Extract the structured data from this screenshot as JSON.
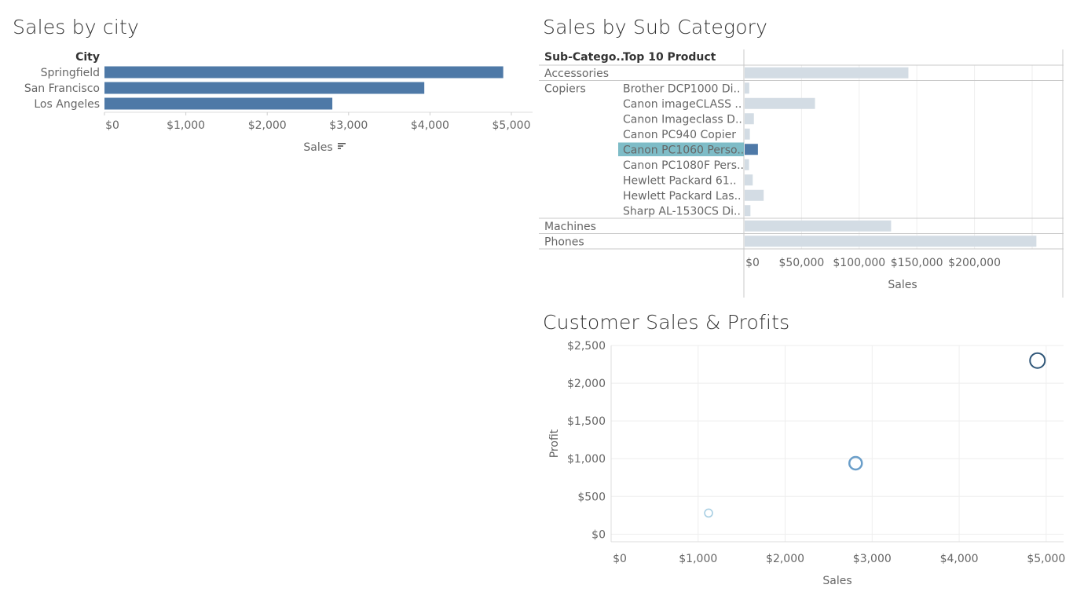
{
  "dashboard": {
    "city_title": "Sales by city",
    "subcat_title": "Sales by Sub Category",
    "scatter_title": "Customer Sales & Profits"
  },
  "chart_data": [
    {
      "type": "bar",
      "title": "Sales by city",
      "row_header": "City",
      "categories": [
        "Springfield",
        "San Francisco",
        "Los Angeles"
      ],
      "values": [
        4900,
        3930,
        2800
      ],
      "xlabel": "Sales",
      "xlim": [
        0,
        5000
      ],
      "xticks": [
        0,
        1000,
        2000,
        3000,
        4000,
        5000
      ],
      "xtick_labels": [
        "$0",
        "$1,000",
        "$2,000",
        "$3,000",
        "$4,000",
        "$5,000"
      ],
      "color": "#4e79a7",
      "sort_icon": "sort-descending-icon"
    },
    {
      "type": "bar",
      "title": "Sales by Sub Category",
      "col_headers": [
        "Sub-Catego..",
        "Top 10 Product"
      ],
      "rows": [
        {
          "subcat": "Accessories",
          "product": "",
          "value": 142000
        },
        {
          "subcat": "Copiers",
          "product": "Brother DCP1000 Di..",
          "value": 4000
        },
        {
          "subcat": "",
          "product": "Canon imageCLASS ..",
          "value": 61000
        },
        {
          "subcat": "",
          "product": "Canon Imageclass D..",
          "value": 8000
        },
        {
          "subcat": "",
          "product": "Canon PC940 Copier",
          "value": 4500
        },
        {
          "subcat": "",
          "product": "Canon PC1060 Perso..",
          "value": 11500,
          "selected": true
        },
        {
          "subcat": "",
          "product": "Canon PC1080F Pers..",
          "value": 3800
        },
        {
          "subcat": "",
          "product": "Hewlett Packard 61..",
          "value": 7000
        },
        {
          "subcat": "",
          "product": "Hewlett Packard Las..",
          "value": 16500
        },
        {
          "subcat": "",
          "product": "Sharp AL-1530CS Di..",
          "value": 5000
        },
        {
          "subcat": "Machines",
          "product": "",
          "value": 127000
        },
        {
          "subcat": "Phones",
          "product": "",
          "value": 253000
        }
      ],
      "xlabel": "Sales",
      "xlim": [
        0,
        265000
      ],
      "xticks": [
        0,
        50000,
        100000,
        150000,
        200000
      ],
      "xtick_labels": [
        "$0",
        "$50,000",
        "$100,000",
        "$150,000",
        "$200,000"
      ],
      "bar_color": "#d3dce4",
      "selected_color": "#4e79a7",
      "selected_label_bg": "#7ebcc7"
    },
    {
      "type": "scatter",
      "title": "Customer Sales & Profits",
      "xlabel": "Sales",
      "ylabel": "Profit",
      "xlim": [
        0,
        5200
      ],
      "ylim": [
        -100,
        2500
      ],
      "xticks": [
        0,
        1000,
        2000,
        3000,
        4000,
        5000
      ],
      "xtick_labels": [
        "$0",
        "$1,000",
        "$2,000",
        "$3,000",
        "$4,000",
        "$5,000"
      ],
      "yticks": [
        0,
        500,
        1000,
        1500,
        2000,
        2500
      ],
      "ytick_labels": [
        "$0",
        "$500",
        "$1,000",
        "$1,500",
        "$2,000",
        "$2,500"
      ],
      "points": [
        {
          "x": 1120,
          "y": 280,
          "size": "small",
          "color": "#a9cfe3"
        },
        {
          "x": 2810,
          "y": 940,
          "size": "medium",
          "color": "#6a9ec9"
        },
        {
          "x": 4900,
          "y": 2300,
          "size": "large",
          "color": "#2f5678"
        }
      ],
      "grid": true
    }
  ]
}
